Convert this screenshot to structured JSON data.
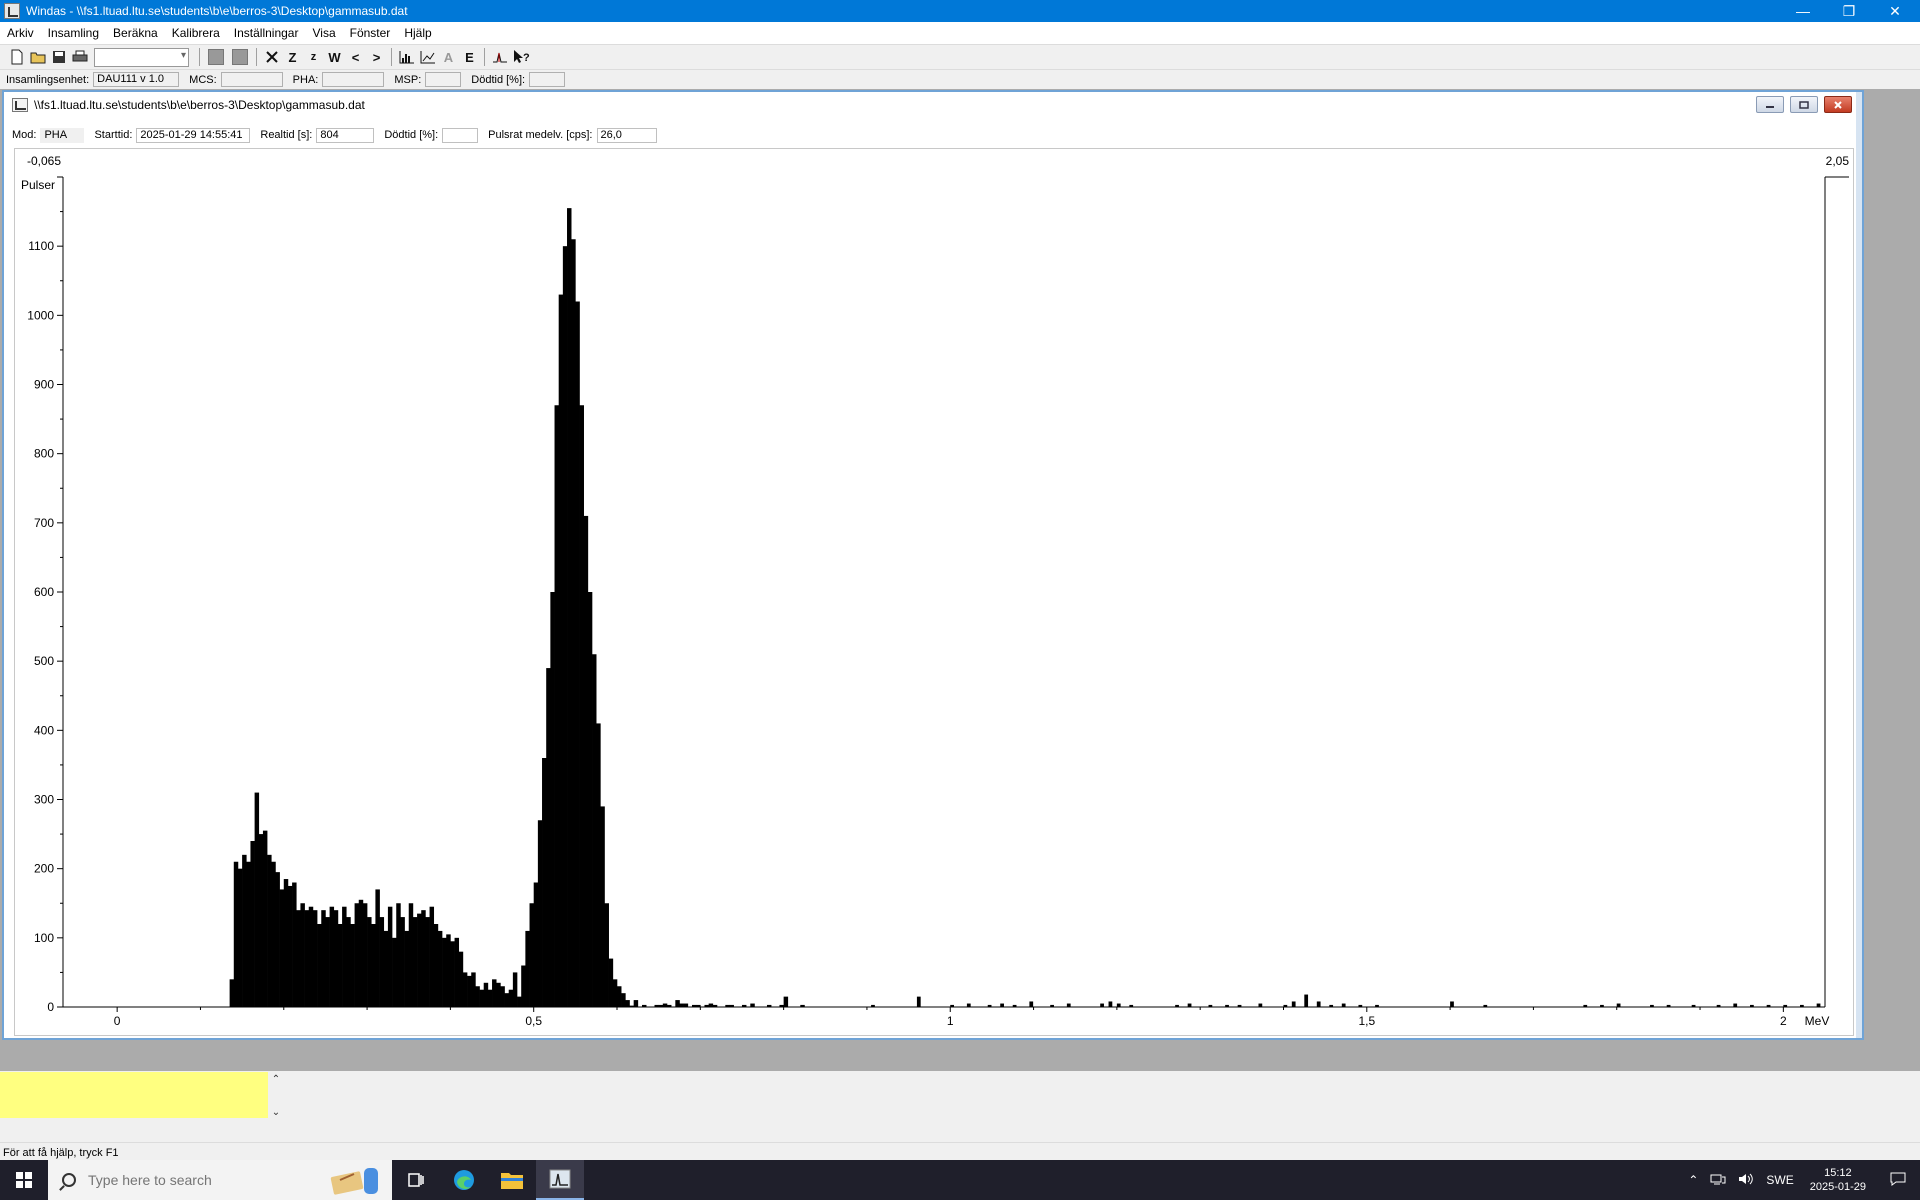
{
  "window": {
    "title": "Windas - \\\\fs1.ltuad.ltu.se\\students\\b\\e\\berros-3\\Desktop\\gammasub.dat",
    "minimize": "—",
    "restore": "❐",
    "close": "✕"
  },
  "menu": [
    "Arkiv",
    "Insamling",
    "Beräkna",
    "Kalibrera",
    "Inställningar",
    "Visa",
    "Fönster",
    "Hjälp"
  ],
  "toolbar": {
    "z_big": "Z",
    "z_small": "z",
    "w": "W",
    "prev": "<",
    "next": ">",
    "e": "E",
    "help": "?"
  },
  "status": {
    "unit_label": "Insamlingsenhet:",
    "unit_value": "DAU111 v 1.0",
    "mcs_label": "MCS:",
    "mcs_value": "",
    "pha_label": "PHA:",
    "pha_value": "",
    "msp_label": "MSP:",
    "msp_value": "",
    "dead_label": "Dödtid [%]:",
    "dead_value": ""
  },
  "child": {
    "title": "\\\\fs1.ltuad.ltu.se\\students\\b\\e\\berros-3\\Desktop\\gammasub.dat",
    "info": {
      "mode_label": "Mod:",
      "mode_value": "PHA",
      "start_label": "Starttid:",
      "start_value": "2025-01-29  14:55:41",
      "real_label": "Realtid [s]:",
      "real_value": "804",
      "dead_label": "Dödtid [%]:",
      "dead_value": "",
      "rate_label": "Pulsrat medelv. [cps]:",
      "rate_value": "26,0"
    }
  },
  "chart_data": {
    "type": "bar",
    "ylabel": "Pulser",
    "xunit": "MeV",
    "x_left_readout": "-0,065",
    "x_right_readout": "2,05",
    "xlim": [
      -0.065,
      2.05
    ],
    "ylim": [
      0,
      1200
    ],
    "yticks": [
      0,
      100,
      200,
      300,
      400,
      500,
      600,
      700,
      800,
      900,
      1000,
      1100
    ],
    "xticks": [
      {
        "value": 0,
        "label": "0"
      },
      {
        "value": 0.5,
        "label": "0,5"
      },
      {
        "value": 1,
        "label": "1"
      },
      {
        "value": 1.5,
        "label": "1,5"
      },
      {
        "value": 2,
        "label": "2"
      }
    ],
    "bin_width": 0.005,
    "bins_start": 0.135,
    "counts": [
      40,
      210,
      200,
      220,
      210,
      240,
      310,
      250,
      255,
      220,
      210,
      195,
      170,
      185,
      175,
      180,
      140,
      150,
      140,
      145,
      140,
      120,
      140,
      130,
      145,
      140,
      120,
      145,
      130,
      120,
      150,
      155,
      150,
      130,
      120,
      170,
      130,
      110,
      145,
      100,
      150,
      130,
      110,
      150,
      130,
      135,
      140,
      130,
      145,
      120,
      110,
      100,
      105,
      95,
      100,
      80,
      50,
      45,
      50,
      30,
      25,
      35,
      25,
      40,
      35,
      30,
      20,
      25,
      50,
      15,
      60,
      110,
      150,
      180,
      270,
      360,
      490,
      600,
      870,
      1030,
      1100,
      1155,
      1110,
      1020,
      870,
      710,
      600,
      510,
      410,
      290,
      150,
      70,
      40,
      30,
      20,
      10,
      2,
      10,
      0,
      3,
      0,
      0,
      3,
      3,
      5,
      3,
      0,
      10,
      5,
      5,
      0,
      3,
      3,
      0,
      3,
      5,
      3,
      0,
      0,
      3,
      3,
      0,
      0,
      3,
      0,
      5,
      0,
      0,
      0,
      3,
      0,
      0,
      3,
      15,
      0,
      0,
      0,
      3
    ],
    "sparse_bins": [
      {
        "x": 0.905,
        "y": 3
      },
      {
        "x": 0.96,
        "y": 15
      },
      {
        "x": 1.0,
        "y": 3
      },
      {
        "x": 1.02,
        "y": 5
      },
      {
        "x": 1.045,
        "y": 3
      },
      {
        "x": 1.06,
        "y": 5
      },
      {
        "x": 1.075,
        "y": 3
      },
      {
        "x": 1.095,
        "y": 8
      },
      {
        "x": 1.12,
        "y": 3
      },
      {
        "x": 1.14,
        "y": 5
      },
      {
        "x": 1.18,
        "y": 5
      },
      {
        "x": 1.19,
        "y": 8
      },
      {
        "x": 1.2,
        "y": 5
      },
      {
        "x": 1.215,
        "y": 3
      },
      {
        "x": 1.27,
        "y": 3
      },
      {
        "x": 1.285,
        "y": 5
      },
      {
        "x": 1.31,
        "y": 3
      },
      {
        "x": 1.33,
        "y": 3
      },
      {
        "x": 1.345,
        "y": 3
      },
      {
        "x": 1.37,
        "y": 5
      },
      {
        "x": 1.4,
        "y": 3
      },
      {
        "x": 1.41,
        "y": 8
      },
      {
        "x": 1.425,
        "y": 18
      },
      {
        "x": 1.44,
        "y": 8
      },
      {
        "x": 1.455,
        "y": 3
      },
      {
        "x": 1.47,
        "y": 5
      },
      {
        "x": 1.49,
        "y": 3
      },
      {
        "x": 1.51,
        "y": 3
      },
      {
        "x": 1.6,
        "y": 8
      },
      {
        "x": 1.64,
        "y": 3
      },
      {
        "x": 1.76,
        "y": 3
      },
      {
        "x": 1.78,
        "y": 3
      },
      {
        "x": 1.8,
        "y": 5
      },
      {
        "x": 1.84,
        "y": 3
      },
      {
        "x": 1.86,
        "y": 3
      },
      {
        "x": 1.89,
        "y": 3
      },
      {
        "x": 1.92,
        "y": 3
      },
      {
        "x": 1.94,
        "y": 5
      },
      {
        "x": 1.96,
        "y": 3
      },
      {
        "x": 1.98,
        "y": 3
      },
      {
        "x": 2.0,
        "y": 3
      },
      {
        "x": 2.02,
        "y": 3
      },
      {
        "x": 2.04,
        "y": 5
      }
    ]
  },
  "appstatus": "För att få hjälp, tryck F1",
  "taskbar": {
    "search_placeholder": "Type here to search",
    "language": "SWE",
    "time": "15:12",
    "date": "2025-01-29"
  }
}
